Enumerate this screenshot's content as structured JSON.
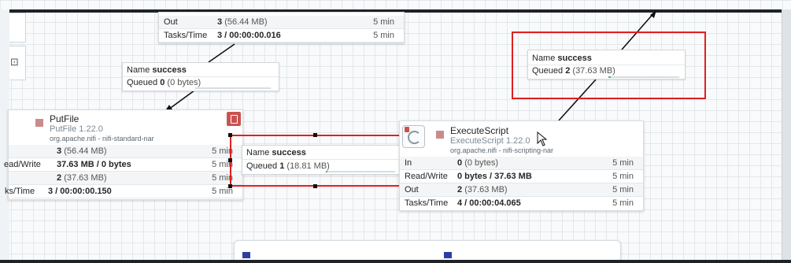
{
  "top_card": {
    "rows": [
      {
        "label": "Out",
        "value": "3",
        "paren": "(56.44 MB)",
        "time": "5 min"
      },
      {
        "label": "Tasks/Time",
        "value": "3 / 00:00:00.016",
        "paren": "",
        "time": "5 min"
      }
    ]
  },
  "conn_top_left": {
    "name_label": "Name",
    "name_value": "success",
    "queued_label": "Queued",
    "queued_value": "0",
    "queued_paren": "(0 bytes)",
    "queued_fill_percent": 0
  },
  "conn_top_right": {
    "name_label": "Name",
    "name_value": "success",
    "queued_label": "Queued",
    "queued_value": "2",
    "queued_paren": "(37.63 MB)",
    "queued_fill_percent": 3
  },
  "conn_middle": {
    "name_label": "Name",
    "name_value": "success",
    "queued_label": "Queued",
    "queued_value": "1",
    "queued_paren": "(18.81 MB)",
    "queued_fill_percent": 2
  },
  "putfile": {
    "name": "PutFile",
    "type": "PutFile 1.22.0",
    "bundle": "org.apache.nifi - nifi-standard-nar",
    "rows": [
      {
        "label": "",
        "value": "3",
        "paren": "(56.44 MB)",
        "time": "5 min"
      },
      {
        "label": "ead/Write",
        "value": "37.63 MB / 0 bytes",
        "paren": "",
        "time": "5 min"
      },
      {
        "label": "",
        "value": "2",
        "paren": "(37.63 MB)",
        "time": "5 min"
      },
      {
        "label": "ks/Time",
        "value": "3 / 00:00:00.150",
        "paren": "",
        "time": "5 min"
      }
    ]
  },
  "executescript": {
    "name": "ExecuteScript",
    "type": "ExecuteScript 1.22.0",
    "bundle": "org.apache.nifi - nifi-scripting-nar",
    "rows": [
      {
        "label": "In",
        "value": "0",
        "paren": "(0 bytes)",
        "time": "5 min"
      },
      {
        "label": "Read/Write",
        "value": "0 bytes / 37.63 MB",
        "paren": "",
        "time": "5 min"
      },
      {
        "label": "Out",
        "value": "2",
        "paren": "(37.63 MB)",
        "time": "5 min"
      },
      {
        "label": "Tasks/Time",
        "value": "4 / 00:00:04.065",
        "paren": "",
        "time": "5 min"
      }
    ]
  },
  "colors": {
    "highlight": "#e02020",
    "bulletin": "#c9534f",
    "processor_icon": "#c98b8b",
    "queue_fill": "#57b26b"
  }
}
